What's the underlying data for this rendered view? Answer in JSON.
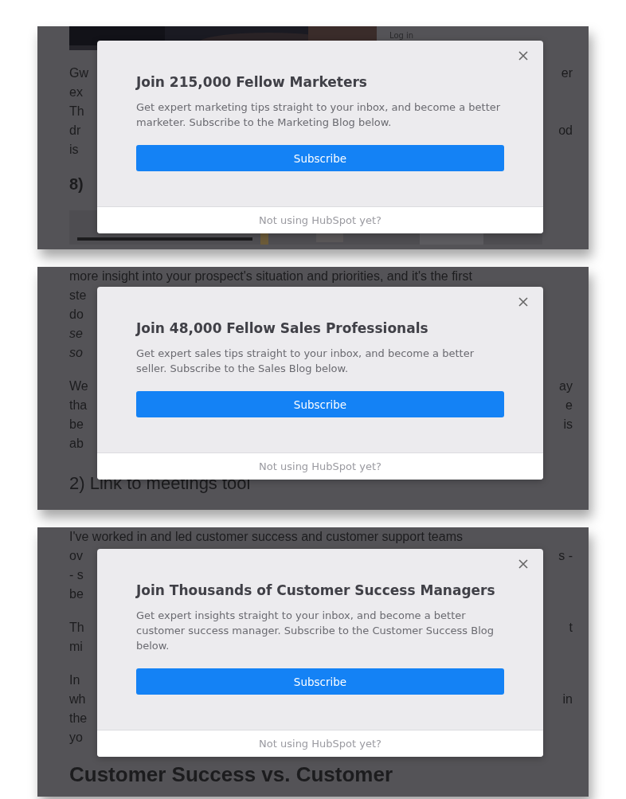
{
  "panels": [
    {
      "blocks": [
        {
          "kind": "media",
          "side_text": "Log in"
        },
        {
          "kind": "body",
          "lines": [
            {
              "left": "Gw",
              "right": "er"
            },
            {
              "left": "ex"
            },
            {
              "left": "Th"
            },
            {
              "left": "dr",
              "right": "od"
            },
            {
              "left": "is"
            }
          ]
        },
        {
          "kind": "subheading",
          "text": "8)"
        },
        {
          "kind": "strip"
        }
      ],
      "modal": {
        "title": "Join 215,000 Fellow Marketers",
        "description": "Get expert marketing tips straight to your inbox, and become a better marketer. Subscribe to the Marketing Blog below.",
        "button": "Subscribe",
        "footer": "Not using HubSpot yet?"
      }
    },
    {
      "blocks": [
        {
          "kind": "body",
          "lines": [
            {
              "left": "more insight into your prospect's situation and priorities, and it's the first"
            },
            {
              "left": "ste"
            },
            {
              "left": "do"
            },
            {
              "left": "se",
              "italic": true
            },
            {
              "left": "so",
              "italic": true
            }
          ]
        },
        {
          "kind": "body",
          "lines": [
            {
              "left": "We",
              "right": "ay"
            },
            {
              "left": "tha",
              "right": "e"
            },
            {
              "left": "be",
              "right": "is"
            },
            {
              "left": "ab"
            }
          ]
        },
        {
          "kind": "heading",
          "text": "2) Link to meetings tool"
        }
      ],
      "modal": {
        "title": "Join 48,000 Fellow Sales Professionals",
        "description": "Get expert sales tips straight to your inbox, and become a better seller. Subscribe to the Sales Blog below.",
        "button": "Subscribe",
        "footer": "Not using HubSpot yet?"
      }
    },
    {
      "blocks": [
        {
          "kind": "body",
          "lines": [
            {
              "left": "I've worked in and led customer success and customer support teams"
            },
            {
              "left": "ov",
              "right": "s -"
            },
            {
              "left": "- s"
            },
            {
              "left": "be"
            }
          ]
        },
        {
          "kind": "body",
          "lines": [
            {
              "left": "Th",
              "right": "t"
            },
            {
              "left": "mi"
            }
          ]
        },
        {
          "kind": "body",
          "lines": [
            {
              "left": "In"
            },
            {
              "left": "wh",
              "right": "in"
            },
            {
              "left": "the"
            },
            {
              "left": "yo"
            }
          ]
        },
        {
          "kind": "title",
          "text": "Customer Success vs. Customer"
        }
      ],
      "modal": {
        "title": "Join Thousands of Customer Success Managers",
        "description": "Get expert insights straight to your inbox, and become a better customer success manager. Subscribe to the Customer Success Blog below.",
        "button": "Subscribe",
        "footer": "Not using HubSpot yet?"
      }
    }
  ]
}
